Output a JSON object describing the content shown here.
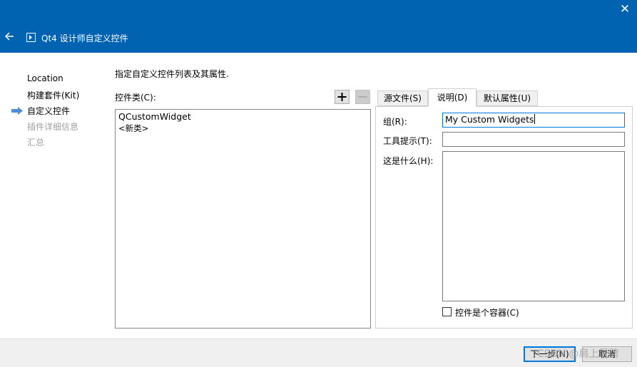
{
  "window": {
    "title": "Qt4 设计师自定义控件"
  },
  "nav": {
    "items": [
      {
        "label": "Location",
        "state": "done"
      },
      {
        "label": "构建套件(Kit)",
        "state": "done"
      },
      {
        "label": "自定义控件",
        "state": "current"
      },
      {
        "label": "插件详细信息",
        "state": "disabled"
      },
      {
        "label": "汇总",
        "state": "disabled"
      }
    ]
  },
  "main": {
    "description": "指定自定义控件列表及其属性.",
    "list_label": "控件类(C):",
    "classes": [
      "QCustomWidget",
      "<新类>"
    ]
  },
  "tabs": [
    {
      "label": "源文件(S)",
      "active": false
    },
    {
      "label": "说明(D)",
      "active": true
    },
    {
      "label": "默认属性(U)",
      "active": false
    }
  ],
  "form": {
    "group_label": "组(R):",
    "group_value": "My  Custom Widgets",
    "tooltip_label": "工具提示(T):",
    "tooltip_value": "",
    "whatsthis_label": "这是什么(H):",
    "whatsthis_value": "",
    "container_label": "控件是个容器(C)",
    "container_checked": false
  },
  "footer": {
    "next_label": "下一步(N)",
    "cancel_label": "取消"
  },
  "watermark": "CSDN @肩上风骋",
  "colors": {
    "titlebar": "#0063b1",
    "focus": "#0078d7",
    "nav_arrow": "#4a8fd8"
  }
}
